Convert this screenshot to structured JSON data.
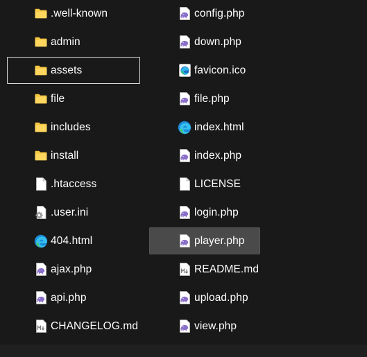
{
  "explorer": {
    "left_column": [
      {
        "label": ".well-known",
        "icon": "folder-icon"
      },
      {
        "label": "admin",
        "icon": "folder-icon"
      },
      {
        "label": "assets",
        "icon": "folder-icon",
        "state": "focused"
      },
      {
        "label": "file",
        "icon": "folder-icon"
      },
      {
        "label": "includes",
        "icon": "folder-icon"
      },
      {
        "label": "install",
        "icon": "folder-icon"
      },
      {
        "label": ".htaccess",
        "icon": "blank-file-icon"
      },
      {
        "label": ".user.ini",
        "icon": "settings-file-icon"
      },
      {
        "label": "404.html",
        "icon": "edge-html-icon"
      },
      {
        "label": "ajax.php",
        "icon": "php-file-icon"
      },
      {
        "label": "api.php",
        "icon": "php-file-icon"
      },
      {
        "label": "CHANGELOG.md",
        "icon": "markdown-file-icon"
      }
    ],
    "right_column": [
      {
        "label": "config.php",
        "icon": "php-file-icon"
      },
      {
        "label": "down.php",
        "icon": "php-file-icon"
      },
      {
        "label": "favicon.ico",
        "icon": "image-file-icon"
      },
      {
        "label": "file.php",
        "icon": "php-file-icon"
      },
      {
        "label": "index.html",
        "icon": "edge-html-icon"
      },
      {
        "label": "index.php",
        "icon": "php-file-icon"
      },
      {
        "label": "LICENSE",
        "icon": "blank-file-icon"
      },
      {
        "label": "login.php",
        "icon": "php-file-icon"
      },
      {
        "label": "player.php",
        "icon": "php-file-icon",
        "state": "hovered"
      },
      {
        "label": "README.md",
        "icon": "markdown-file-icon"
      },
      {
        "label": "upload.php",
        "icon": "php-file-icon"
      },
      {
        "label": "view.php",
        "icon": "php-file-icon"
      }
    ]
  },
  "colors": {
    "background": "#191919",
    "folder": "#f5c642",
    "hover": "#4a4a4a",
    "focus_border": "#d9d9d9",
    "php_elephant": "#8a6fc9"
  }
}
